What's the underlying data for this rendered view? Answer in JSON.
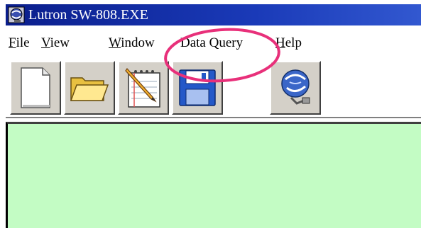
{
  "window": {
    "title": "Lutron SW-808.EXE"
  },
  "menu": {
    "items": [
      {
        "label": "File",
        "mnemonic": "F",
        "rest": "ile"
      },
      {
        "label": "View",
        "mnemonic": "V",
        "rest": "iew"
      },
      {
        "label": "Window",
        "mnemonic": "W",
        "rest": "indow"
      },
      {
        "label": "Data Query",
        "mnemonic": "",
        "rest": "Data Query"
      },
      {
        "label": "Help",
        "mnemonic": "H",
        "rest": "elp"
      }
    ]
  },
  "toolbar": {
    "buttons": [
      {
        "name": "new-file",
        "icon": "blank-page-icon"
      },
      {
        "name": "open-folder",
        "icon": "folder-icon"
      },
      {
        "name": "notepad",
        "icon": "notepad-pencil-icon"
      },
      {
        "name": "save",
        "icon": "floppy-disk-icon"
      },
      {
        "name": "connect",
        "icon": "globe-connect-icon"
      }
    ]
  },
  "annotation": {
    "color": "#e8307a",
    "target": "Data Query"
  },
  "colors": {
    "titlebar": "#0a1e8c",
    "client_area": "#c3fcc4",
    "button_face": "#d4d0c8"
  }
}
